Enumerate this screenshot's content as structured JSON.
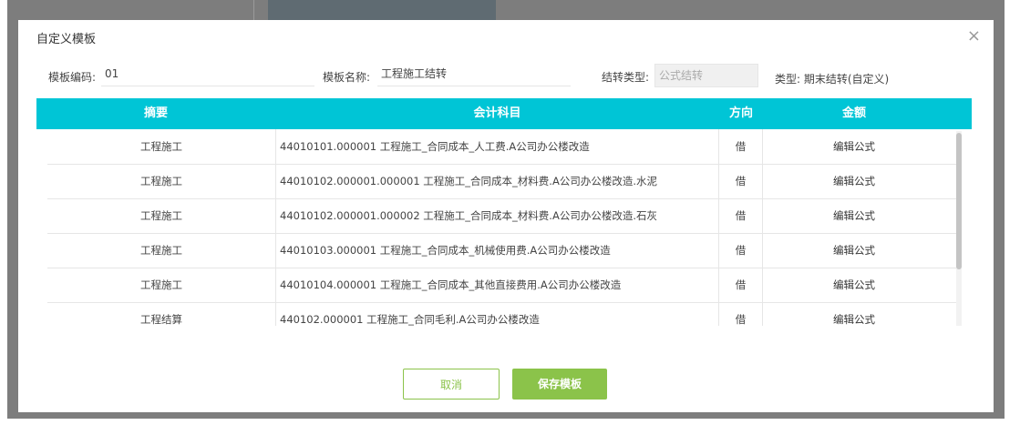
{
  "modal": {
    "title": "自定义模板",
    "close": "×"
  },
  "form": {
    "code_label": "模板编码:",
    "code_value": "01",
    "name_label": "模板名称:",
    "name_value": "工程施工结转",
    "type_label": "结转类型:",
    "type_value": "公式结转",
    "kind_text": "类型: 期末结转(自定义)"
  },
  "table": {
    "headers": [
      "摘要",
      "会计科目",
      "方向",
      "金额"
    ],
    "rows": [
      {
        "summary": "工程施工",
        "account": "44010101.000001 工程施工_合同成本_人工费.A公司办公楼改造",
        "direction": "借",
        "amount": "编辑公式"
      },
      {
        "summary": "工程施工",
        "account": "44010102.000001.000001 工程施工_合同成本_材料费.A公司办公楼改造.水泥",
        "direction": "借",
        "amount": "编辑公式"
      },
      {
        "summary": "工程施工",
        "account": "44010102.000001.000002 工程施工_合同成本_材料费.A公司办公楼改造.石灰",
        "direction": "借",
        "amount": "编辑公式"
      },
      {
        "summary": "工程施工",
        "account": "44010103.000001 工程施工_合同成本_机械使用费.A公司办公楼改造",
        "direction": "借",
        "amount": "编辑公式"
      },
      {
        "summary": "工程施工",
        "account": "44010104.000001 工程施工_合同成本_其他直接费用.A公司办公楼改造",
        "direction": "借",
        "amount": "编辑公式"
      },
      {
        "summary": "工程结算",
        "account": "440102.000001 工程施工_合同毛利.A公司办公楼改造",
        "direction": "借",
        "amount": "编辑公式"
      }
    ]
  },
  "buttons": {
    "cancel": "取消",
    "save": "保存模板"
  },
  "colors": {
    "header_bg": "#00c5d6",
    "primary_green": "#8bc34a"
  }
}
